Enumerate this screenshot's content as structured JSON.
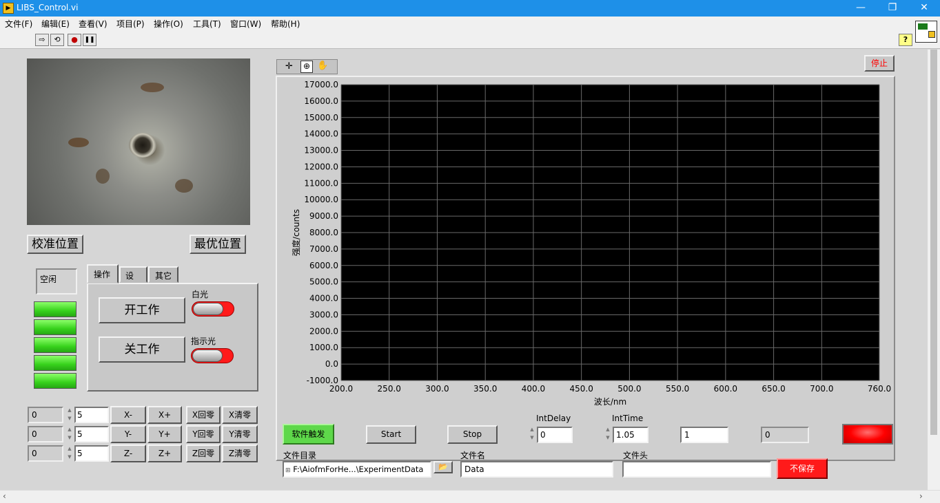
{
  "window": {
    "title": "LIBS_Control.vi",
    "icon": "labview-vi-icon",
    "minimize": "—",
    "maximize": "❐",
    "close": "✕"
  },
  "menu": [
    "文件(F)",
    "编辑(E)",
    "查看(V)",
    "项目(P)",
    "操作(O)",
    "工具(T)",
    "窗口(W)",
    "帮助(H)"
  ],
  "toolbar": {
    "run": "⇨",
    "run_cont": "⟲",
    "abort": "●",
    "pause": "❚❚",
    "help": "?"
  },
  "left": {
    "calib_btn": "校准位置",
    "best_btn": "最优位置",
    "status": "空闲",
    "tabs": [
      "操作",
      "设置",
      "其它"
    ],
    "active_tab": "操作",
    "start_work": "开工作",
    "stop_work": "关工作",
    "white_light": "白光",
    "indicator_light": "指示光",
    "axes": [
      {
        "pos": "0",
        "step": "5",
        "minus": "X-",
        "plus": "X+",
        "home": "X回零",
        "clear": "X清零"
      },
      {
        "pos": "0",
        "step": "5",
        "minus": "Y-",
        "plus": "Y+",
        "home": "Y回零",
        "clear": "Y清零"
      },
      {
        "pos": "0",
        "step": "5",
        "minus": "Z-",
        "plus": "Z+",
        "home": "Z回零",
        "clear": "Z清零"
      }
    ]
  },
  "graph": {
    "stop_btn": "停止",
    "palette": [
      "✛",
      "⊕",
      "✋"
    ],
    "colors": {
      "plot_bg": "#000000",
      "grid": "#6a6a6a",
      "stop_text": "#ff0000"
    }
  },
  "chart_data": {
    "type": "line",
    "series": [],
    "xlabel": "波长/nm",
    "ylabel": "强度/counts",
    "xlim": [
      200,
      760
    ],
    "ylim": [
      -1000,
      17000
    ],
    "x_ticks": [
      "200.0",
      "250.0",
      "300.0",
      "350.0",
      "400.0",
      "450.0",
      "500.0",
      "550.0",
      "600.0",
      "650.0",
      "700.0",
      "760.0"
    ],
    "y_ticks": [
      "17000.0",
      "16000.0",
      "15000.0",
      "14000.0",
      "13000.0",
      "12000.0",
      "11000.0",
      "10000.0",
      "9000.0",
      "8000.0",
      "7000.0",
      "6000.0",
      "5000.0",
      "4000.0",
      "3000.0",
      "2000.0",
      "1000.0",
      "0.0",
      "-1000.0"
    ],
    "grid": true
  },
  "bottom": {
    "soft_trigger": "软件触发",
    "start": "Start",
    "stop": "Stop",
    "int_delay_label": "IntDelay",
    "int_delay": "0",
    "int_time_label": "IntTime",
    "int_time": "1.05",
    "count_input": "1",
    "count_display": "0",
    "dir_label": "文件目录",
    "dir_value": "F:\\AiofmForHe...\\ExperimentData",
    "name_label": "文件名",
    "name_value": "Data",
    "header_label": "文件头",
    "header_value": "",
    "no_save": "不保存"
  }
}
